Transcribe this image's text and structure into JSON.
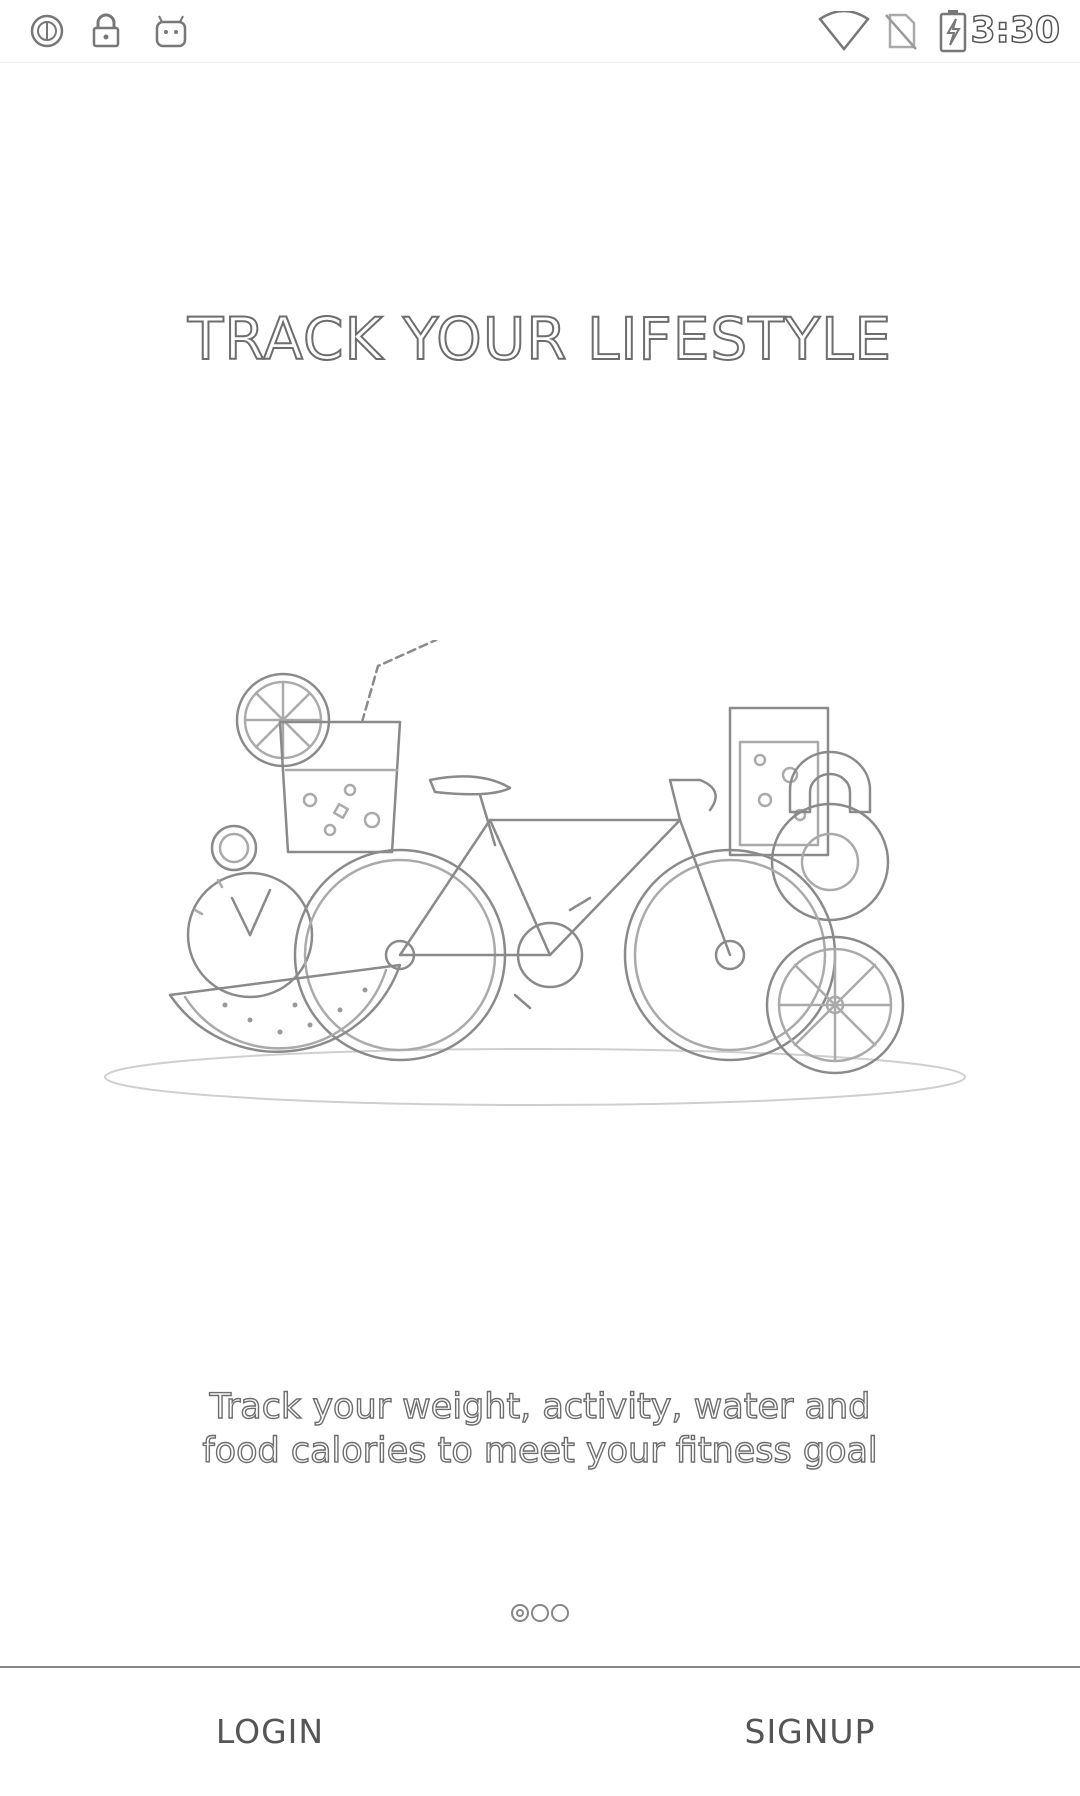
{
  "status_bar": {
    "time": "3:30",
    "left_icons": [
      "sync-icon",
      "lock-icon",
      "android-icon"
    ],
    "right_icons": [
      "wifi-icon",
      "no-sim-icon",
      "battery-charging-icon"
    ]
  },
  "onboarding": {
    "headline": "TRACK YOUR LIFESTYLE",
    "description_line1": "Track your weight, activity, water and",
    "description_line2": "food calories to meet your fitness goal",
    "illustration_icons": [
      "bicycle-icon",
      "juice-glass-icon",
      "water-glass-icon",
      "kettlebell-icon",
      "stopwatch-icon",
      "watermelon-icon",
      "orange-slice-icon",
      "lemon-slice-icon"
    ],
    "pager": {
      "count": 3,
      "active_index": 0
    }
  },
  "actions": {
    "login_label": "LOGIN",
    "signup_label": "SIGNUP"
  }
}
